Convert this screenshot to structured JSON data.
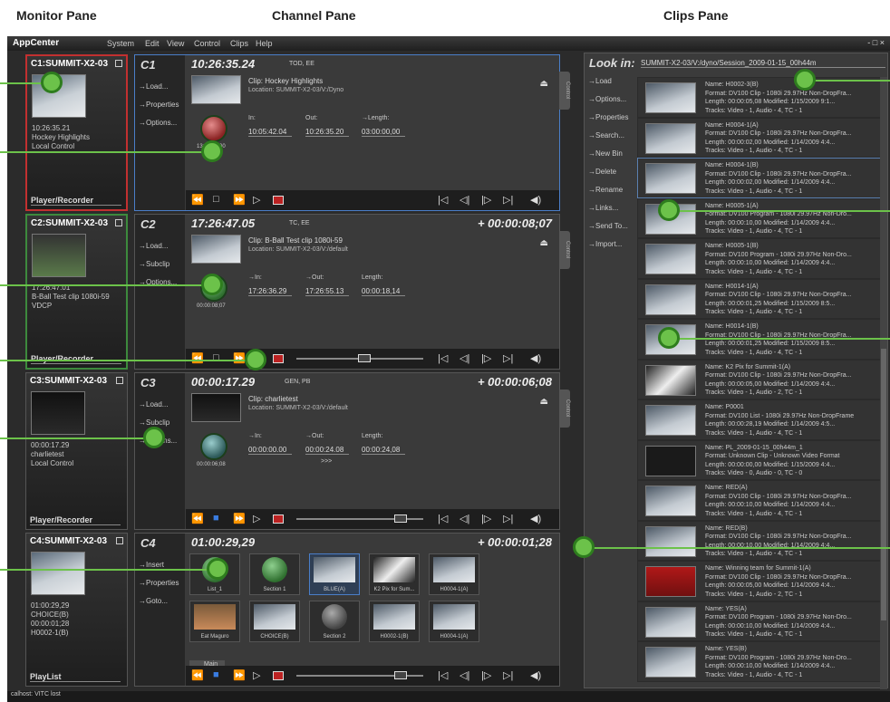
{
  "pane_titles": {
    "monitor": "Monitor Pane",
    "channel": "Channel Pane",
    "clips": "Clips Pane"
  },
  "menu": {
    "logo": "AppCenter",
    "system": "System",
    "edit": "Edit",
    "view": "View",
    "control": "Control",
    "clips": "Clips",
    "help": "Help",
    "window_controls": "- □ ×"
  },
  "monitors": [
    {
      "title": "C1:SUMMIT-X2-03",
      "info": [
        "10:26:35.21",
        "Hockey Highlights",
        "Local Control"
      ],
      "foot": "Player/Recorder"
    },
    {
      "title": "C2:SUMMIT-X2-03",
      "info": [
        "17:26:47.01",
        "B-Ball Test clip 1080i-59",
        "VDCP"
      ],
      "foot": "Player/Recorder"
    },
    {
      "title": "C3:SUMMIT-X2-03",
      "info": [
        "00:00:17.29",
        "charlietest",
        "Local Control"
      ],
      "foot": "Player/Recorder"
    },
    {
      "title": "C4:SUMMIT-X2-03",
      "info": [
        "01:00:29,29",
        "CHOICE(B)",
        "00:00:01;28",
        "H0002-1(B)"
      ],
      "foot": "PlayList"
    }
  ],
  "channels": [
    {
      "name": "C1",
      "timecode": "10:26:35.24",
      "tc_suffix": "TOD, EE",
      "remaining": "",
      "links": [
        "→Load...",
        "→Properties",
        "→Options..."
      ],
      "clip": "Clip:  Hockey Highlights",
      "location": "Location: SUMMIT-X2-03/V:/Dyno",
      "labels": [
        "In:",
        "Out:",
        "→Length:"
      ],
      "values": [
        "10:05:42.04",
        "10:26:35.20",
        "03:00:00,00"
      ],
      "knob_time": "13:36:10,00",
      "tab": "Control"
    },
    {
      "name": "C2",
      "timecode": "17:26:47.05",
      "tc_suffix": "TC, EE",
      "remaining": "+ 00:00:08;07",
      "links": [
        "→Load...",
        "→Subclip",
        "→Options..."
      ],
      "clip": "Clip:  B-Ball Test clip 1080i-59",
      "location": "Location: SUMMIT-X2-03/V:/default",
      "labels": [
        "→In:",
        "→Out:",
        "Length:"
      ],
      "values": [
        "17:26:36.29",
        "17:26:55.13",
        "00:00:18,14"
      ],
      "knob_time": "00:00:08;07",
      "tab": "Control"
    },
    {
      "name": "C3",
      "timecode": "00:00:17.29",
      "tc_suffix": "GEN, PB",
      "remaining": "+ 00:00:06;08",
      "links": [
        "→Load...",
        "→Subclip",
        "→Options..."
      ],
      "clip": "Clip:  charlietest",
      "location": "Location: SUMMIT-X2-03/V:/default",
      "labels": [
        "→In:",
        "→Out:",
        "Length:"
      ],
      "values": [
        "00:00:00.00",
        "00:00:24.08",
        "00:00:24,08"
      ],
      "knob_time": "00:00:06;08",
      "extra": ">>>",
      "tab": "Control"
    },
    {
      "name": "C4",
      "timecode": "01:00:29,29",
      "tc_suffix": "",
      "remaining": "+ 00:00:01;28",
      "links": [
        "→Insert",
        "→Properties",
        "→Goto..."
      ],
      "playlist": [
        "List_1",
        "Section 1",
        "BLUE(A)",
        "K2 Pix for Sum...",
        "H0004-1(A)",
        "Eat Maguro",
        "CHOICE(B)",
        "Section 2",
        "H0002-1(B)",
        "H0004-1(A)"
      ],
      "tab_main": "Main"
    }
  ],
  "clips_pane": {
    "look_in": "Look in:",
    "path": "SUMMIT-X2-03/V:/dyno/Session_2009-01-15_00h44m",
    "actions": [
      "→Load",
      "→Options...",
      "→Properties",
      "→Search...",
      "→New Bin",
      "→Delete",
      "→Rename",
      "→Links...",
      "→Send To...",
      "→Import..."
    ],
    "items": [
      {
        "name": "Name: H0002-3(B)",
        "format": "Format: DV100 Clip - 1080i 29.97Hz Non-DropFra...",
        "length": "Length: 00:00:05,08     Modified: 1/15/2009 9:1...",
        "tracks": "Tracks: Video - 1, Audio - 4, TC - 1"
      },
      {
        "name": "Name: H0004-1(A)",
        "format": "Format: DV100 Clip - 1080i 29.97Hz Non-DropFra...",
        "length": "Length: 00:00:02,00     Modified: 1/14/2009 4:4...",
        "tracks": "Tracks: Video - 1, Audio - 4, TC - 1"
      },
      {
        "name": "Name: H0004-1(B)",
        "format": "Format: DV100 Clip - 1080i 29.97Hz Non-DropFra...",
        "length": "Length: 00:00:02,00     Modified: 1/14/2009 4:4...",
        "tracks": "Tracks: Video - 1, Audio - 4, TC - 1"
      },
      {
        "name": "Name: H0005-1(A)",
        "format": "Format: DV100 Program - 1080i 29.97Hz Non-Dro...",
        "length": "Length: 00:00:10,00     Modified: 1/14/2009 4:4...",
        "tracks": "Tracks: Video - 1, Audio - 4, TC - 1"
      },
      {
        "name": "Name: H0005-1(B)",
        "format": "Format: DV100 Program - 1080i 29.97Hz Non-Dro...",
        "length": "Length: 00:00:10,00     Modified: 1/14/2009 4:4...",
        "tracks": "Tracks: Video - 1, Audio - 4, TC - 1"
      },
      {
        "name": "Name: H0014-1(A)",
        "format": "Format: DV100 Clip - 1080i 29.97Hz Non-DropFra...",
        "length": "Length: 00:00:01,25     Modified: 1/15/2009 8:5...",
        "tracks": "Tracks: Video - 1, Audio - 4, TC - 1"
      },
      {
        "name": "Name: H0014-1(B)",
        "format": "Format: DV100 Clip - 1080i 29.97Hz Non-DropFra...",
        "length": "Length: 00:00:01,25     Modified: 1/15/2009 8:5...",
        "tracks": "Tracks: Video - 1, Audio - 4, TC - 1"
      },
      {
        "name": "Name: K2 Pix for Summit-1(A)",
        "format": "Format: DV100 Clip - 1080i 29.97Hz Non-DropFra...",
        "length": "Length: 00:00:05,00     Modified: 1/14/2009 4:4...",
        "tracks": "Tracks: Video - 1, Audio - 2, TC - 1"
      },
      {
        "name": "Name: P0001",
        "format": "Format: DV100 List - 1080i 29.97Hz Non-DropFrame",
        "length": "Length: 00:00:28,19     Modified: 1/14/2009 4:5...",
        "tracks": "Tracks: Video - 1, Audio - 4, TC - 1"
      },
      {
        "name": "Name: PL_2009-01-15_00h44m_1",
        "format": "Format: Unknown Clip - Unknown Video Format",
        "length": "Length: 00:00:00,00     Modified: 1/15/2009 4:4...",
        "tracks": "Tracks: Video - 0, Audio - 0, TC - 0"
      },
      {
        "name": "Name: RED(A)",
        "format": "Format: DV100 Clip - 1080i 29.97Hz Non-DropFra...",
        "length": "Length: 00:00:10,00     Modified: 1/14/2009 4:4...",
        "tracks": "Tracks: Video - 1, Audio - 4, TC - 1"
      },
      {
        "name": "Name: RED(B)",
        "format": "Format: DV100 Clip - 1080i 29.97Hz Non-DropFra...",
        "length": "Length: 00:00:10,00     Modified: 1/14/2009 4:4...",
        "tracks": "Tracks: Video - 1, Audio - 4, TC - 1"
      },
      {
        "name": "Name: Winning team for Summit-1(A)",
        "format": "Format: DV100 Clip - 1080i 29.97Hz Non-DropFra...",
        "length": "Length: 00:00:05,00     Modified: 1/14/2009 4:4...",
        "tracks": "Tracks: Video - 1, Audio - 2, TC - 1"
      },
      {
        "name": "Name: YES(A)",
        "format": "Format: DV100 Program - 1080i 29.97Hz Non-Dro...",
        "length": "Length: 00:00:10,00     Modified: 1/14/2009 4:4...",
        "tracks": "Tracks: Video - 1, Audio - 4, TC - 1"
      },
      {
        "name": "Name: YES(B)",
        "format": "Format: DV100 Program - 1080i 29.97Hz Non-Dro...",
        "length": "Length: 00:00:10,00     Modified: 1/14/2009 4:4...",
        "tracks": "Tracks: Video - 1, Audio - 4, TC - 1"
      }
    ]
  },
  "status": "calhost: VITC lost",
  "colors": {
    "selected": "#4a7ec8",
    "record": "#cc2222",
    "callout": "#6cc24a"
  }
}
